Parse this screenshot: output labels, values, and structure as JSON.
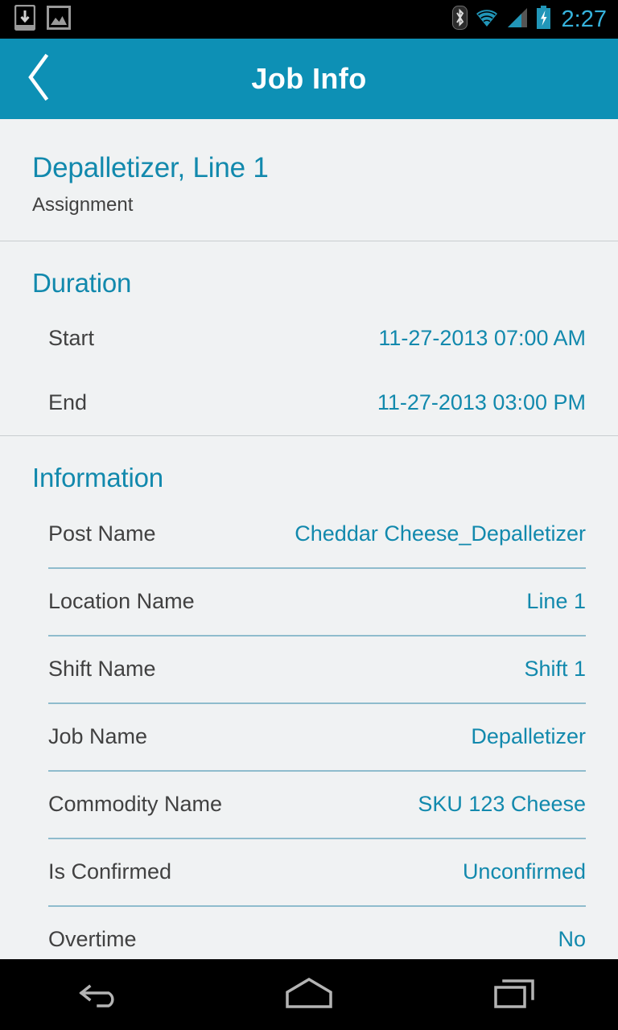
{
  "status_bar": {
    "left_icons": [
      "download-to-device-icon",
      "image-icon"
    ],
    "right_icons": [
      "bluetooth-icon",
      "wifi-icon",
      "cell-signal-icon",
      "battery-charging-icon"
    ],
    "clock": "2:27"
  },
  "action_bar": {
    "back_icon": "chevron-left-icon",
    "title": "Job Info"
  },
  "hero": {
    "title": "Depalletizer, Line 1",
    "subtitle": "Assignment"
  },
  "duration": {
    "header": "Duration",
    "rows": [
      {
        "label": "Start",
        "value": "11-27-2013 07:00 AM"
      },
      {
        "label": "End",
        "value": "11-27-2013 03:00 PM"
      }
    ]
  },
  "information": {
    "header": "Information",
    "rows": [
      {
        "label": "Post Name",
        "value": "Cheddar Cheese_Depalletizer"
      },
      {
        "label": "Location Name",
        "value": "Line 1"
      },
      {
        "label": "Shift Name",
        "value": "Shift 1"
      },
      {
        "label": "Job Name",
        "value": "Depalletizer"
      },
      {
        "label": "Commodity Name",
        "value": "SKU 123 Cheese"
      },
      {
        "label": "Is Confirmed",
        "value": "Unconfirmed"
      },
      {
        "label": "Overtime",
        "value": "No"
      }
    ]
  },
  "nav_bar": {
    "buttons": [
      "back-nav-icon",
      "home-nav-icon",
      "recents-nav-icon"
    ]
  },
  "colors": {
    "accent": "#1289ad",
    "action_bar": "#0d90b5",
    "background": "#f0f2f3",
    "label_text": "#414141",
    "divider": "#8fbccd",
    "section_rule": "#c9cdd0",
    "status_clock": "#36b3dd"
  }
}
